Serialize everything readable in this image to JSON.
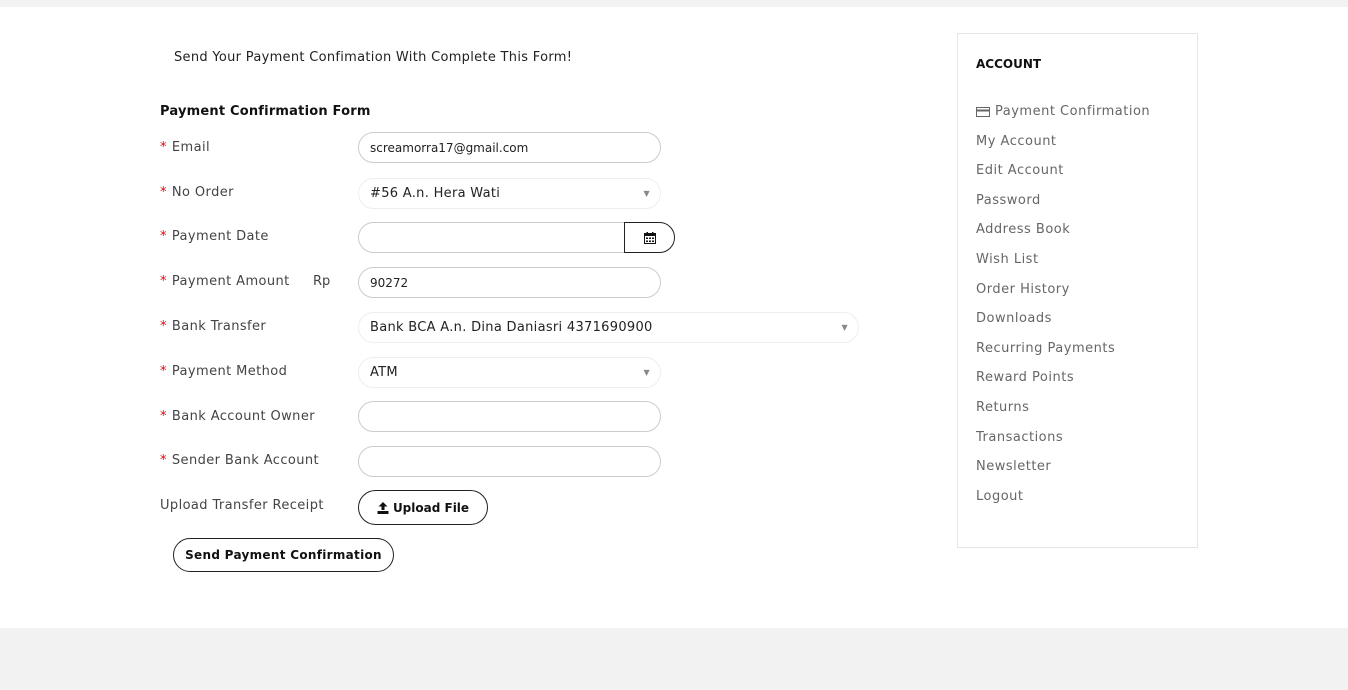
{
  "intro_text": "Send Your Payment Confimation With Complete This Form!",
  "form": {
    "title": "Payment Confirmation Form",
    "required_mark": "*",
    "email": {
      "label": "Email",
      "value": "screamorra17@gmail.com"
    },
    "no_order": {
      "label": "No Order",
      "value": "#56 A.n. Hera Wati"
    },
    "payment_date": {
      "label": "Payment Date",
      "value": ""
    },
    "payment_amount": {
      "label": "Payment Amount",
      "prefix": "Rp",
      "value": "90272"
    },
    "bank_transfer": {
      "label": "Bank Transfer",
      "value": "Bank BCA A.n. Dina Daniasri 4371690900"
    },
    "payment_method": {
      "label": "Payment Method",
      "value": "ATM"
    },
    "bank_account_owner": {
      "label": "Bank Account Owner",
      "value": ""
    },
    "sender_bank_account": {
      "label": "Sender Bank Account",
      "value": ""
    },
    "upload": {
      "label": "Upload Transfer Receipt",
      "button": "Upload File"
    },
    "submit_label": "Send Payment Confirmation"
  },
  "sidebar": {
    "title": "ACCOUNT",
    "items": [
      {
        "label": "Payment Confirmation",
        "icon": "credit-card-icon"
      },
      {
        "label": "My Account"
      },
      {
        "label": "Edit Account"
      },
      {
        "label": "Password"
      },
      {
        "label": "Address Book"
      },
      {
        "label": "Wish List"
      },
      {
        "label": "Order History"
      },
      {
        "label": "Downloads"
      },
      {
        "label": "Recurring Payments"
      },
      {
        "label": "Reward Points"
      },
      {
        "label": "Returns"
      },
      {
        "label": "Transactions"
      },
      {
        "label": "Newsletter"
      },
      {
        "label": "Logout"
      }
    ]
  },
  "colors": {
    "required": "#ee0000",
    "border": "#cccccc",
    "footer": "#f2f2f2"
  }
}
